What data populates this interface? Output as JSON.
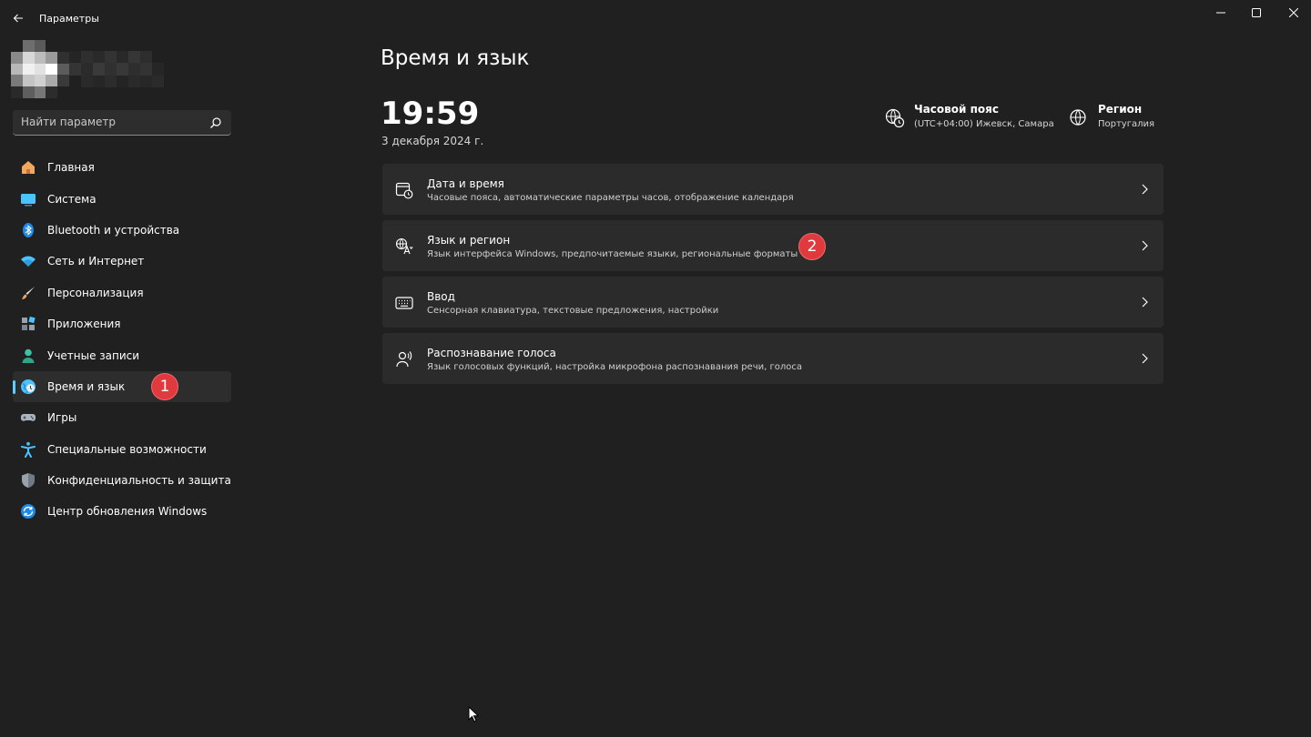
{
  "window": {
    "title": "Параметры"
  },
  "search": {
    "placeholder": "Найти параметр"
  },
  "sidebar": {
    "items": [
      {
        "label": "Главная",
        "icon": "home-icon"
      },
      {
        "label": "Система",
        "icon": "system-icon"
      },
      {
        "label": "Bluetooth и устройства",
        "icon": "bluetooth-icon"
      },
      {
        "label": "Сеть и Интернет",
        "icon": "wifi-icon"
      },
      {
        "label": "Персонализация",
        "icon": "brush-icon"
      },
      {
        "label": "Приложения",
        "icon": "apps-icon"
      },
      {
        "label": "Учетные записи",
        "icon": "account-icon"
      },
      {
        "label": "Время и язык",
        "icon": "time-language-icon",
        "active": true
      },
      {
        "label": "Игры",
        "icon": "gamepad-icon"
      },
      {
        "label": "Специальные возможности",
        "icon": "accessibility-icon"
      },
      {
        "label": "Конфиденциальность и защита",
        "icon": "shield-icon"
      },
      {
        "label": "Центр обновления Windows",
        "icon": "update-icon"
      }
    ]
  },
  "main": {
    "title": "Время и язык",
    "time": "19:59",
    "date": "3 декабря 2024 г.",
    "timezone": {
      "title": "Часовой пояс",
      "value": "(UTC+04:00) Ижевск, Самара"
    },
    "region": {
      "title": "Регион",
      "value": "Португалия"
    },
    "cards": [
      {
        "title": "Дата и время",
        "subtitle": "Часовые пояса, автоматические параметры часов, отображение календаря",
        "icon": "calendar-clock-icon"
      },
      {
        "title": "Язык и регион",
        "subtitle": "Язык интерфейса Windows, предпочитаемые языки, региональные форматы",
        "icon": "language-icon"
      },
      {
        "title": "Ввод",
        "subtitle": "Сенсорная клавиатура, текстовые предложения, настройки",
        "icon": "keyboard-icon"
      },
      {
        "title": "Распознавание голоса",
        "subtitle": "Язык голосовых функций, настройка микрофона распознавания речи, голоса",
        "icon": "speech-icon"
      }
    ]
  },
  "annotations": {
    "badge1": "1",
    "badge2": "2"
  },
  "colors": {
    "background": "#202020",
    "card": "#2b2b2b",
    "accent": "#60cdff",
    "badge": "#e0393e"
  }
}
